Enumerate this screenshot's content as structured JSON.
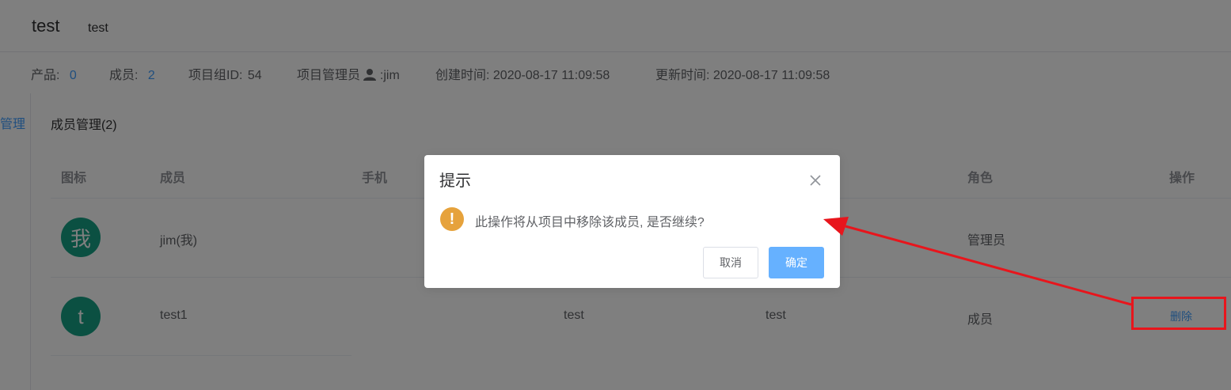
{
  "header": {
    "title": "test",
    "subtitle": "test"
  },
  "meta": {
    "product_label": "产品:",
    "product_value": "0",
    "member_label": "成员:",
    "member_value": "2",
    "group_id_label": "项目组ID:",
    "group_id_value": "54",
    "admin_label": "项目管理员",
    "admin_value": ":jim",
    "created_label": "创建时间:",
    "created_value": "2020-08-17 11:09:58",
    "updated_label": "更新时间:",
    "updated_value": "2020-08-17 11:09:58"
  },
  "sidebar": {
    "link_label": "管理"
  },
  "members": {
    "section_title": "成员管理(2)",
    "columns": [
      "图标",
      "成员",
      "手机",
      "角色",
      "操作"
    ],
    "rows": [
      {
        "avatar": "我",
        "name": "jim(我)",
        "phone": "",
        "email": "",
        "role": "管理员",
        "action": ""
      },
      {
        "avatar": "t",
        "name": "test1",
        "phone": "test",
        "email": "test",
        "role": "成员",
        "action": "删除"
      }
    ]
  },
  "dialog": {
    "title": "提示",
    "icon": "warning-icon",
    "message": "此操作将从项目中移除该成员, 是否继续?",
    "cancel_label": "取消",
    "confirm_label": "确定"
  },
  "annotation": {
    "box_color": "#e8151c",
    "arrow_color": "#e8151c"
  },
  "colors": {
    "accent": "#409eff",
    "avatar": "#16a085",
    "warning": "#e6a23c",
    "confirm": "#66b1ff"
  }
}
